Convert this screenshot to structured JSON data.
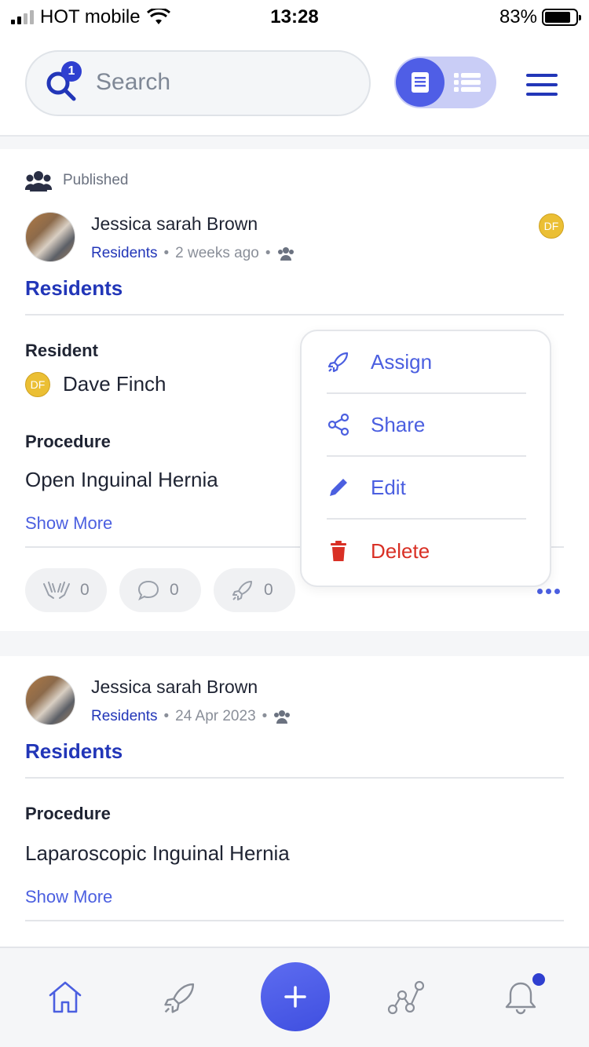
{
  "status_bar": {
    "carrier": "HOT mobile",
    "time": "13:28",
    "battery": "83%"
  },
  "header": {
    "search_placeholder": "Search",
    "search_badge": "1"
  },
  "posts": [
    {
      "status": "Published",
      "author": "Jessica sarah Brown",
      "group": "Residents",
      "time": "2 weeks ago",
      "badge": "DF",
      "title": "Residents",
      "resident_label": "Resident",
      "resident_badge": "DF",
      "resident_name": "Dave Finch",
      "procedure_label": "Procedure",
      "procedure_value": "Open Inguinal Hernia",
      "show_more": "Show More",
      "counts": {
        "hands": "0",
        "comments": "0",
        "assign": "0"
      }
    },
    {
      "author": "Jessica sarah Brown",
      "group": "Residents",
      "time": "24 Apr 2023",
      "title": "Residents",
      "procedure_label": "Procedure",
      "procedure_value": "Laparoscopic Inguinal Hernia",
      "show_more": "Show More"
    }
  ],
  "context_menu": {
    "assign": "Assign",
    "share": "Share",
    "edit": "Edit",
    "delete": "Delete"
  },
  "colors": {
    "brand": "#2236b8",
    "accent": "#4b5fe0",
    "danger": "#d93025",
    "badge": "#ebbf34"
  }
}
